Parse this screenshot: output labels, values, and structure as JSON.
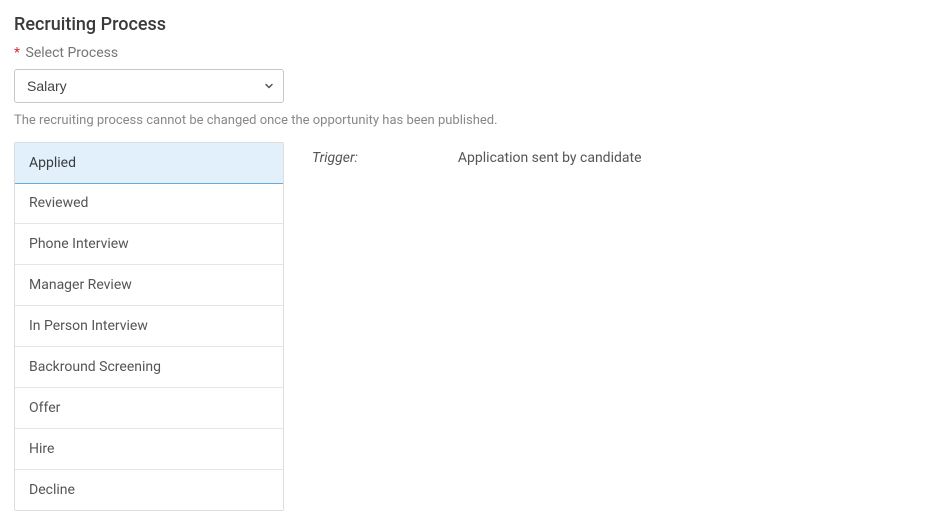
{
  "heading": "Recruiting Process",
  "field": {
    "required_mark": "*",
    "label": "Select Process",
    "selected": "Salary"
  },
  "helper_text": "The recruiting process cannot be changed once the opportunity has been published.",
  "stages": [
    {
      "label": "Applied",
      "active": true
    },
    {
      "label": "Reviewed",
      "active": false
    },
    {
      "label": "Phone Interview",
      "active": false
    },
    {
      "label": "Manager Review",
      "active": false
    },
    {
      "label": "In Person Interview",
      "active": false
    },
    {
      "label": "Backround Screening",
      "active": false
    },
    {
      "label": "Offer",
      "active": false
    },
    {
      "label": "Hire",
      "active": false
    },
    {
      "label": "Decline",
      "active": false
    }
  ],
  "detail": {
    "trigger_label": "Trigger:",
    "trigger_value": "Application sent by candidate"
  }
}
